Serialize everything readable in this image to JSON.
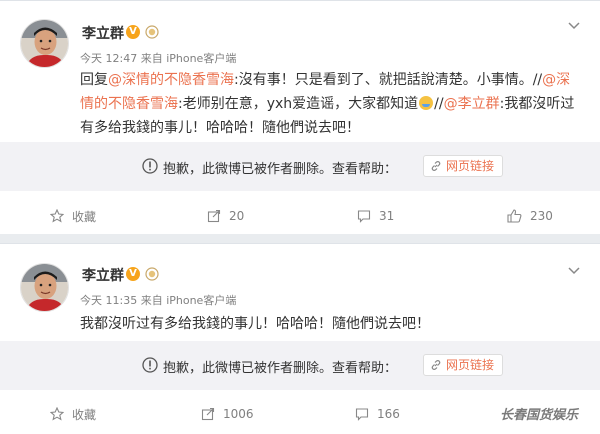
{
  "posts": [
    {
      "username": "李立群",
      "verified_badge": "V",
      "meta": "今天 12:47 来自 iPhone客户端",
      "content": {
        "p1": "回复",
        "m1": "@深情的不隐香雪海",
        "p2": ":沒有事！只是看到了、就把話說清楚。小事情。//",
        "m2": "@深情的不隐香雪海",
        "p3": ":老师别在意，yxh爱造谣，大家都知道",
        "p4": "//",
        "m3": "@李立群",
        "p5": ":我都沒听过有多给我錢的事儿！哈哈哈！隨他們说去吧！"
      },
      "repost_notice": "抱歉，此微博已被作者删除。查看帮助：",
      "repost_link": "网页链接",
      "actions": {
        "favorite": "收藏",
        "repost": "20",
        "comment": "31",
        "like": "230"
      }
    },
    {
      "username": "李立群",
      "verified_badge": "V",
      "meta": "今天 11:35 来自 iPhone客户端",
      "content": {
        "p1": "我都沒听过有多给我錢的事儿！哈哈哈！隨他們说去吧！"
      },
      "repost_notice": "抱歉，此微博已被作者删除。查看帮助：",
      "repost_link": "网页链接",
      "actions": {
        "favorite": "收藏",
        "repost": "1006",
        "comment": "166"
      }
    }
  ],
  "watermark": "长春国货娱乐",
  "colors": {
    "mention": "#eb7350",
    "verified": "#f7a41b",
    "meta": "#808080",
    "repost_bg": "#f2f2f5"
  }
}
